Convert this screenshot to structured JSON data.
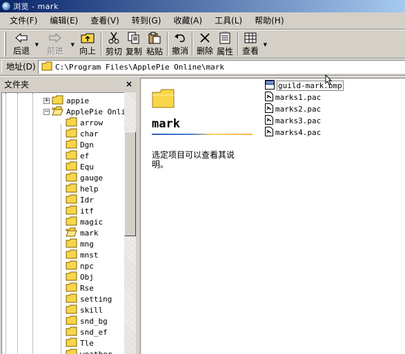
{
  "window": {
    "title": "浏览 - mark"
  },
  "menu": [
    {
      "label": "文件(F)"
    },
    {
      "label": "编辑(E)"
    },
    {
      "label": "查看(V)"
    },
    {
      "label": "转到(G)"
    },
    {
      "label": "收藏(A)"
    },
    {
      "label": "工具(L)"
    },
    {
      "label": "帮助(H)"
    }
  ],
  "toolbar": {
    "back": "后退",
    "forward": "前进",
    "up": "向上",
    "cut": "剪切",
    "copy": "复制",
    "paste": "粘贴",
    "undo": "撤消",
    "delete": "删除",
    "properties": "属性",
    "view": "查看"
  },
  "address": {
    "label": "地址(D)",
    "path": "C:\\Program Files\\ApplePie Online\\mark"
  },
  "folders_pane": {
    "title": "文件夹",
    "close": "×",
    "tree": [
      {
        "name": "appie",
        "expander": "+"
      },
      {
        "name": "ApplePie Onlin",
        "expander": "−"
      },
      {
        "name": "arrow"
      },
      {
        "name": "char"
      },
      {
        "name": "Dgn"
      },
      {
        "name": "ef"
      },
      {
        "name": "Equ"
      },
      {
        "name": "gauge"
      },
      {
        "name": "help"
      },
      {
        "name": "Idr"
      },
      {
        "name": "itf"
      },
      {
        "name": "magic"
      },
      {
        "name": "mark",
        "selected": true
      },
      {
        "name": "mng"
      },
      {
        "name": "mnst"
      },
      {
        "name": "npc"
      },
      {
        "name": "Obj"
      },
      {
        "name": "Rse"
      },
      {
        "name": "setting"
      },
      {
        "name": "skill"
      },
      {
        "name": "snd_bg"
      },
      {
        "name": "snd_ef"
      },
      {
        "name": "Tle"
      },
      {
        "name": "weather"
      }
    ]
  },
  "content": {
    "folder_name": "mark",
    "description": "选定项目可以查看其说明。",
    "files": [
      {
        "name": "guild-mark.bmp",
        "type": "bmp",
        "selected": true
      },
      {
        "name": "marks1.pac",
        "type": "pac"
      },
      {
        "name": "marks2.pac",
        "type": "pac"
      },
      {
        "name": "marks3.pac",
        "type": "pac"
      },
      {
        "name": "marks4.pac",
        "type": "pac"
      }
    ]
  },
  "scroll": {
    "position_fraction": 0.15,
    "visible_fraction": 0.55
  },
  "colors": {
    "title_bar_start": "#0a246a",
    "title_bar_end": "#a6caf0",
    "folder_yellow": "#f7d64a",
    "face": "#d4d0c8"
  }
}
